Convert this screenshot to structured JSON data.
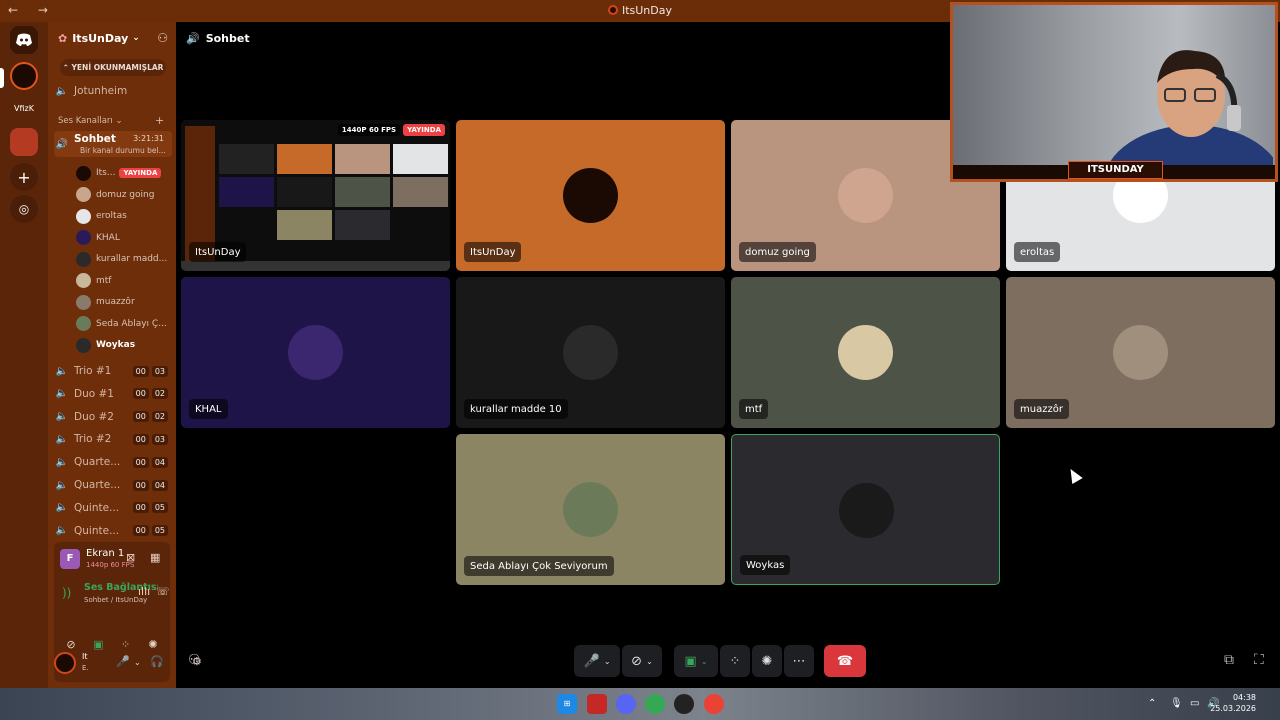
{
  "window": {
    "title": "ItsUnDay",
    "nav": "← →"
  },
  "server": {
    "name": "ItsUnDay",
    "unread_pill": "YENİ OKUNMAMIŞLAR",
    "rail_label": "VfizK"
  },
  "channels": {
    "top": "Jotunheim",
    "category": "Ses Kanalları",
    "active": {
      "name": "Sohbet",
      "timer": "3:21:31",
      "status": "Bir kanal durumu bel..."
    },
    "members": [
      {
        "name": "Its...",
        "live": "YAYINDA",
        "color": "#1b0a03"
      },
      {
        "name": "domuz going",
        "color": "#c9a58c"
      },
      {
        "name": "eroltas",
        "color": "#e6e6e6"
      },
      {
        "name": "KHAL",
        "color": "#2b1a5a"
      },
      {
        "name": "kurallar madd...",
        "color": "#2a2a2a"
      },
      {
        "name": "mtf",
        "color": "#c8b89a"
      },
      {
        "name": "muazzôr",
        "color": "#8a7a6a"
      },
      {
        "name": "Seda Ablayı Ç...",
        "color": "#6b7b5a"
      },
      {
        "name": "Woykas",
        "color": "#2a2a2a",
        "bold": true
      }
    ],
    "voice_rooms": [
      {
        "name": "Trio #1",
        "a": "00",
        "b": "03"
      },
      {
        "name": "Duo #1",
        "a": "00",
        "b": "02"
      },
      {
        "name": "Duo #2",
        "a": "00",
        "b": "02"
      },
      {
        "name": "Trio #2",
        "a": "00",
        "b": "03"
      },
      {
        "name": "Quarte...",
        "a": "00",
        "b": "04"
      },
      {
        "name": "Quarte...",
        "a": "00",
        "b": "04"
      },
      {
        "name": "Quinte...",
        "a": "00",
        "b": "05"
      },
      {
        "name": "Quinte...",
        "a": "00",
        "b": "05"
      }
    ]
  },
  "panel": {
    "screen_letter": "F",
    "screen_name": "Ekran 1",
    "screen_quality": "1440p 60 FPS",
    "voice_status": "Ses Bağlantısı K",
    "voice_sub": "Sohbet / ItsUnDay",
    "user_name": "It",
    "user_status": "E."
  },
  "main": {
    "channel_title": "Sohbet"
  },
  "tiles": [
    {
      "name": "ItsUnDay",
      "bg": "#111111",
      "stream": true,
      "quality": "1440P 60 FPS",
      "live": "YAYINDA"
    },
    {
      "name": "ItsUnDay",
      "bg": "#c66a2a",
      "av": "#1b0a03"
    },
    {
      "name": "domuz going",
      "bg": "#b99580",
      "av": "#cfa58f"
    },
    {
      "name": "eroltas",
      "bg": "#e3e4e6",
      "av": "#ffffff"
    },
    {
      "name": "KHAL",
      "bg": "#1f1447",
      "av": "#3b2670"
    },
    {
      "name": "kurallar madde 10",
      "bg": "#181818",
      "av": "#2a2a2a"
    },
    {
      "name": "mtf",
      "bg": "#4e5348",
      "av": "#d8c8a4"
    },
    {
      "name": "muazzôr",
      "bg": "#7d6e5f",
      "av": "#a08f7c"
    },
    {
      "name": "Seda Ablayı Çok Seviyorum",
      "bg": "#8c8564",
      "av": "#6b7b5a"
    },
    {
      "name": "Woykas",
      "bg": "#2b2a2e",
      "av": "#1a1a1a",
      "selected": true
    }
  ],
  "webcam": {
    "banner": "ITSUNDAY"
  },
  "taskbar": {
    "time": "04:38",
    "date": "25.03.2026"
  }
}
